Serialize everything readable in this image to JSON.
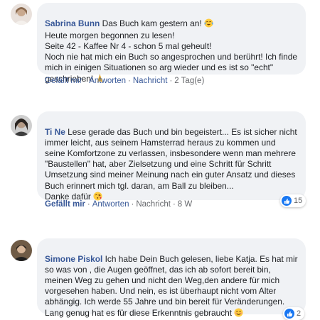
{
  "comments": [
    {
      "name": "Sabrina Bunn",
      "text": " Das Buch kam gestern an! ",
      "text_rest": "Heute morgen begonnen zu lesen!\nSeite 42 - Kaffee Nr 4 - schon 5 mal geheult!\nNoch nie hat mich ein Buch so angesprochen und berührt! Ich finde mich in einigen Situationen so arg wieder und es ist so \"echt\" geschrieben! ",
      "actions": {
        "like": "Gefällt mir",
        "reply": "Antworten",
        "message": "Nachricht",
        "time": "2 Tag(e)"
      },
      "emoji1": "crying-smile-emoji",
      "emoji2": "folded-hands-emoji"
    },
    {
      "name": "Ti Ne",
      "text": " Lese gerade das Buch und bin begeistert... Es ist sicher nicht immer leicht, aus seinem Hamsterrad heraus zu kommen und seine Komfortzone zu verlassen, insbesondere wenn man mehrere \"Baustellen\" hat, aber Zielsetzung und eine Schritt für Schritt Umsetzung sind meiner Meinung nach ein guter Ansatz und dieses Buch erinnert mich tgl. daran, am Ball zu bleiben...\nDanke dafür ",
      "actions": {
        "like": "Gefällt mir",
        "reply": "Antworten",
        "message": "Nachricht",
        "time": "8 W"
      },
      "reactions": "15",
      "emoji1": "kissing-heart-emoji"
    },
    {
      "name": "Simone Piskol",
      "text": " Ich habe Dein Buch gelesen, liebe Katja. Es hat mir so was von , die Augen geöffnet, das ich ab sofort bereit bin, meinen Weg zu gehen und nicht den Weg,den andere für mich vorgesehen haben. Und nein, es ist überhaupt nicht vom Alter abhängig. Ich werde 55 Jahre und bin bereit für Veränderungen. Lang genug hat es für diese Erkenntnis gebraucht ",
      "reactions": "2",
      "emoji1": "smiling-blush-emoji"
    }
  ],
  "colors": {
    "bubble": "#f0f2f5",
    "name": "#385898",
    "meta": "#65676b",
    "like_blue": "#1877f2"
  }
}
